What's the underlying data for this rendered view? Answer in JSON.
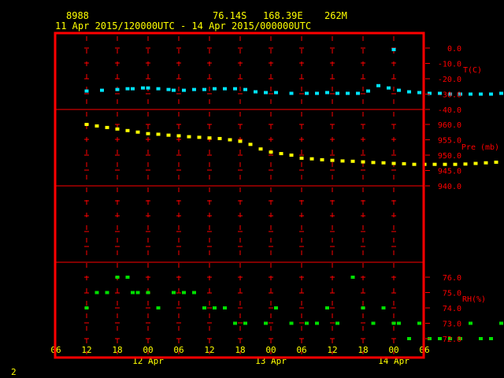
{
  "header": {
    "station_id": "8988",
    "lat": "76.14S",
    "lon": "168.39E",
    "elev": "262M",
    "time_range": "11 Apr 2015/120000UTC - 14 Apr 2015/000000UTC"
  },
  "page_number": "2",
  "colors": {
    "frame": "#ff0000",
    "axis_text": "#ff0000",
    "tick_text": "#ffff00",
    "temperature": "#00e5ff",
    "pressure": "#ffff00",
    "rh": "#00e000"
  },
  "chart_data": [
    {
      "type": "scatter",
      "ylabel": "T(C)",
      "ylim": [
        -40.0,
        0.0
      ],
      "y_ticks": [
        "0.0",
        "-10.0",
        "-20.0",
        "-30.0",
        "-40.0"
      ],
      "x_unit": "hours from 11 Apr 2015 12 UTC",
      "series": [
        {
          "x": [
            0,
            3,
            6,
            8,
            9,
            11,
            12,
            14,
            16,
            17,
            19,
            21,
            23,
            25,
            27,
            29,
            31,
            33,
            35,
            37,
            40,
            43,
            45,
            47,
            49,
            51,
            53,
            55,
            57,
            59,
            61,
            63,
            65,
            67,
            69,
            71,
            73,
            75,
            77,
            79,
            81,
            83
          ],
          "y": [
            -28.0,
            -27.5,
            -27.0,
            -26.5,
            -26.5,
            -26.0,
            -26.0,
            -26.5,
            -27.0,
            -27.5,
            -27.5,
            -27.0,
            -27.0,
            -26.5,
            -26.5,
            -26.5,
            -27.0,
            -28.5,
            -29.0,
            -29.0,
            -29.5,
            -29.5,
            -29.5,
            -29.0,
            -29.5,
            -29.5,
            -29.5,
            -28.0,
            -24.5,
            -26.0,
            -27.5,
            -28.5,
            -29.0,
            -29.5,
            -29.5,
            -30.0,
            -30.0,
            -30.0,
            -30.0,
            -30.0,
            -29.5,
            -29.0
          ]
        },
        {
          "x": [
            60
          ],
          "y": [
            -1.0
          ]
        }
      ]
    },
    {
      "type": "scatter",
      "ylabel": "Pre (mb)",
      "ylim": [
        940.0,
        960.0
      ],
      "y_ticks": [
        "960.0",
        "955.0",
        "950.0",
        "945.0",
        "940.0"
      ],
      "series": [
        {
          "x": [
            0,
            2,
            4,
            6,
            8,
            10,
            12,
            14,
            16,
            18,
            20,
            22,
            24,
            26,
            28,
            30,
            32,
            34,
            36,
            38,
            40,
            42,
            44,
            46,
            48,
            50,
            52,
            54,
            56,
            58,
            60,
            62,
            64,
            66,
            68,
            70,
            72,
            74,
            76,
            78,
            80,
            82,
            84
          ],
          "y": [
            960.0,
            959.5,
            959.0,
            958.5,
            958.0,
            957.5,
            957.0,
            956.8,
            956.5,
            956.3,
            956.0,
            955.8,
            955.6,
            955.4,
            955.0,
            954.5,
            953.5,
            952.0,
            951.0,
            950.5,
            950.0,
            949.0,
            948.8,
            948.5,
            948.3,
            948.1,
            948.0,
            947.8,
            947.6,
            947.5,
            947.3,
            947.2,
            947.0,
            947.0,
            947.0,
            947.0,
            947.0,
            947.1,
            947.3,
            947.5,
            947.7,
            948.0,
            948.3
          ]
        }
      ]
    },
    {
      "type": "scatter",
      "ylabel": "RH(%)",
      "ylim": [
        72.0,
        76.0
      ],
      "y_ticks": [
        "76.0",
        "75.0",
        "74.0",
        "73.0",
        "72.0"
      ],
      "series": [
        {
          "x": [
            0,
            2,
            4,
            6,
            8,
            9,
            10,
            12,
            14,
            17,
            19,
            21,
            23,
            25,
            27,
            29,
            31,
            35,
            37,
            40,
            43,
            45,
            47,
            49,
            52,
            54,
            56,
            58,
            60,
            61,
            63,
            65,
            67,
            69,
            71,
            73,
            75,
            77,
            79,
            81,
            83
          ],
          "y": [
            74.0,
            75.0,
            75.0,
            76.0,
            76.0,
            75.0,
            75.0,
            75.0,
            74.0,
            75.0,
            75.0,
            75.0,
            74.0,
            74.0,
            74.0,
            73.0,
            73.0,
            73.0,
            74.0,
            73.0,
            73.0,
            73.0,
            74.0,
            73.0,
            76.0,
            74.0,
            73.0,
            74.0,
            73.0,
            73.0,
            72.0,
            73.0,
            72.0,
            72.0,
            72.0,
            72.0,
            73.0,
            72.0,
            72.0,
            73.0,
            74.0
          ]
        }
      ]
    }
  ],
  "x_axis": {
    "ticks": [
      "06",
      "12",
      "18",
      "00",
      "06",
      "12",
      "18",
      "00",
      "06",
      "12",
      "18",
      "00",
      "06"
    ],
    "tick_hours": [
      -6,
      0,
      6,
      12,
      18,
      24,
      30,
      36,
      42,
      48,
      54,
      60,
      66,
      72,
      78,
      84,
      90
    ],
    "date_labels": [
      "12 Apr",
      "13 Apr",
      "14 Apr"
    ]
  }
}
